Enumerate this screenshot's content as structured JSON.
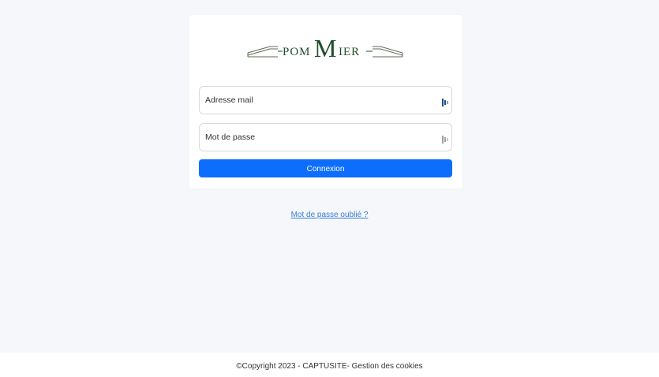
{
  "logo": {
    "text": "POMMIER",
    "color": "#1f4d2a"
  },
  "form": {
    "email_placeholder": "Adresse mail",
    "password_placeholder": "Mot de passe",
    "submit_label": "Connexion",
    "button_color": "#0d6efd"
  },
  "links": {
    "forgot_password": "Mot de passe oublié ?"
  },
  "footer": {
    "copyright": "©Copyright 2023 - CAPTUSITE",
    "separator": "- ",
    "cookies": "Gestion des cookies"
  }
}
